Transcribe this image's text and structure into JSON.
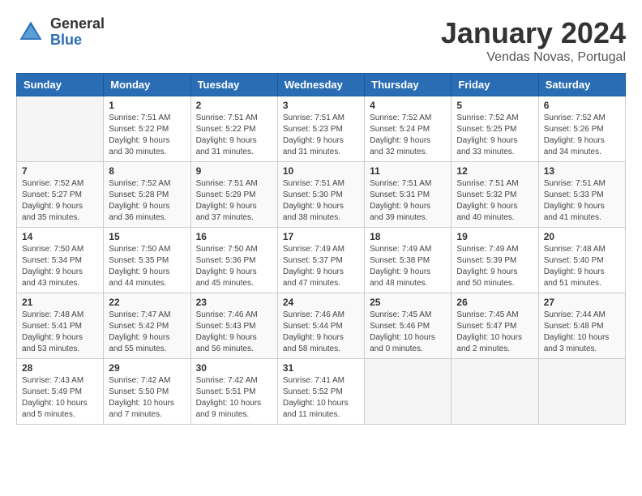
{
  "header": {
    "logo_general": "General",
    "logo_blue": "Blue",
    "month_year": "January 2024",
    "location": "Vendas Novas, Portugal"
  },
  "calendar": {
    "days_of_week": [
      "Sunday",
      "Monday",
      "Tuesday",
      "Wednesday",
      "Thursday",
      "Friday",
      "Saturday"
    ],
    "weeks": [
      [
        {
          "day": "",
          "info": ""
        },
        {
          "day": "1",
          "info": "Sunrise: 7:51 AM\nSunset: 5:22 PM\nDaylight: 9 hours\nand 30 minutes."
        },
        {
          "day": "2",
          "info": "Sunrise: 7:51 AM\nSunset: 5:22 PM\nDaylight: 9 hours\nand 31 minutes."
        },
        {
          "day": "3",
          "info": "Sunrise: 7:51 AM\nSunset: 5:23 PM\nDaylight: 9 hours\nand 31 minutes."
        },
        {
          "day": "4",
          "info": "Sunrise: 7:52 AM\nSunset: 5:24 PM\nDaylight: 9 hours\nand 32 minutes."
        },
        {
          "day": "5",
          "info": "Sunrise: 7:52 AM\nSunset: 5:25 PM\nDaylight: 9 hours\nand 33 minutes."
        },
        {
          "day": "6",
          "info": "Sunrise: 7:52 AM\nSunset: 5:26 PM\nDaylight: 9 hours\nand 34 minutes."
        }
      ],
      [
        {
          "day": "7",
          "info": "Sunrise: 7:52 AM\nSunset: 5:27 PM\nDaylight: 9 hours\nand 35 minutes."
        },
        {
          "day": "8",
          "info": "Sunrise: 7:52 AM\nSunset: 5:28 PM\nDaylight: 9 hours\nand 36 minutes."
        },
        {
          "day": "9",
          "info": "Sunrise: 7:51 AM\nSunset: 5:29 PM\nDaylight: 9 hours\nand 37 minutes."
        },
        {
          "day": "10",
          "info": "Sunrise: 7:51 AM\nSunset: 5:30 PM\nDaylight: 9 hours\nand 38 minutes."
        },
        {
          "day": "11",
          "info": "Sunrise: 7:51 AM\nSunset: 5:31 PM\nDaylight: 9 hours\nand 39 minutes."
        },
        {
          "day": "12",
          "info": "Sunrise: 7:51 AM\nSunset: 5:32 PM\nDaylight: 9 hours\nand 40 minutes."
        },
        {
          "day": "13",
          "info": "Sunrise: 7:51 AM\nSunset: 5:33 PM\nDaylight: 9 hours\nand 41 minutes."
        }
      ],
      [
        {
          "day": "14",
          "info": "Sunrise: 7:50 AM\nSunset: 5:34 PM\nDaylight: 9 hours\nand 43 minutes."
        },
        {
          "day": "15",
          "info": "Sunrise: 7:50 AM\nSunset: 5:35 PM\nDaylight: 9 hours\nand 44 minutes."
        },
        {
          "day": "16",
          "info": "Sunrise: 7:50 AM\nSunset: 5:36 PM\nDaylight: 9 hours\nand 45 minutes."
        },
        {
          "day": "17",
          "info": "Sunrise: 7:49 AM\nSunset: 5:37 PM\nDaylight: 9 hours\nand 47 minutes."
        },
        {
          "day": "18",
          "info": "Sunrise: 7:49 AM\nSunset: 5:38 PM\nDaylight: 9 hours\nand 48 minutes."
        },
        {
          "day": "19",
          "info": "Sunrise: 7:49 AM\nSunset: 5:39 PM\nDaylight: 9 hours\nand 50 minutes."
        },
        {
          "day": "20",
          "info": "Sunrise: 7:48 AM\nSunset: 5:40 PM\nDaylight: 9 hours\nand 51 minutes."
        }
      ],
      [
        {
          "day": "21",
          "info": "Sunrise: 7:48 AM\nSunset: 5:41 PM\nDaylight: 9 hours\nand 53 minutes."
        },
        {
          "day": "22",
          "info": "Sunrise: 7:47 AM\nSunset: 5:42 PM\nDaylight: 9 hours\nand 55 minutes."
        },
        {
          "day": "23",
          "info": "Sunrise: 7:46 AM\nSunset: 5:43 PM\nDaylight: 9 hours\nand 56 minutes."
        },
        {
          "day": "24",
          "info": "Sunrise: 7:46 AM\nSunset: 5:44 PM\nDaylight: 9 hours\nand 58 minutes."
        },
        {
          "day": "25",
          "info": "Sunrise: 7:45 AM\nSunset: 5:46 PM\nDaylight: 10 hours\nand 0 minutes."
        },
        {
          "day": "26",
          "info": "Sunrise: 7:45 AM\nSunset: 5:47 PM\nDaylight: 10 hours\nand 2 minutes."
        },
        {
          "day": "27",
          "info": "Sunrise: 7:44 AM\nSunset: 5:48 PM\nDaylight: 10 hours\nand 3 minutes."
        }
      ],
      [
        {
          "day": "28",
          "info": "Sunrise: 7:43 AM\nSunset: 5:49 PM\nDaylight: 10 hours\nand 5 minutes."
        },
        {
          "day": "29",
          "info": "Sunrise: 7:42 AM\nSunset: 5:50 PM\nDaylight: 10 hours\nand 7 minutes."
        },
        {
          "day": "30",
          "info": "Sunrise: 7:42 AM\nSunset: 5:51 PM\nDaylight: 10 hours\nand 9 minutes."
        },
        {
          "day": "31",
          "info": "Sunrise: 7:41 AM\nSunset: 5:52 PM\nDaylight: 10 hours\nand 11 minutes."
        },
        {
          "day": "",
          "info": ""
        },
        {
          "day": "",
          "info": ""
        },
        {
          "day": "",
          "info": ""
        }
      ]
    ]
  }
}
